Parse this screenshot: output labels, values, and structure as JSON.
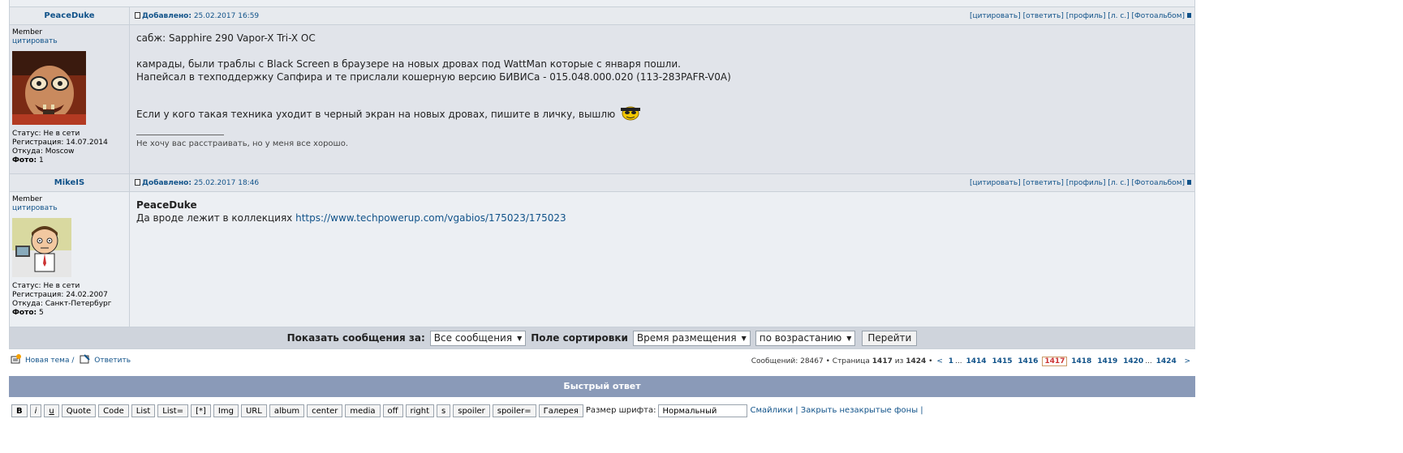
{
  "actions": {
    "quote": "[цитировать]",
    "reply": "[ответить]",
    "profile": "[профиль]",
    "pm": "[л. с.]",
    "photoalbum": "[Фотоальбом]"
  },
  "labels": {
    "added": "Добавлено:",
    "status": "Статус:",
    "registration": "Регистрация:",
    "from": "Откуда:",
    "photo": "Фото:"
  },
  "posts": [
    {
      "author": "PeaceDuke",
      "rank": "Member",
      "quote_link": "цитировать",
      "date": "25.02.2017 16:59",
      "status": "Не в сети",
      "registered": "14.07.2014",
      "location": "Moscow",
      "photos": "1",
      "lines": [
        "сабж: Sapphire 290 Vapor-X Tri-X OC",
        "камрады, были траблы с Black Screen в браузере на новых дровах под WattMan которые с января пошли.",
        "Напейсал в техподдержку Сапфира и те прислали кошерную версию БИВИСа - 015.048.000.020 (113-283PAFR-V0A)",
        "Если у кого такая техника уходит в черный экран на новых дровах, пишите в личку, вышлю"
      ],
      "signature": "Не хочу вас расстраивать, но у меня все хорошо."
    },
    {
      "author": "MikeIS",
      "rank": "Member",
      "quote_link": "цитировать",
      "date": "25.02.2017 18:46",
      "status": "Не в сети",
      "registered": "24.02.2007",
      "location": "Санкт-Петербург",
      "photos": "5",
      "reply_to": "PeaceDuke",
      "text": "Да вроде лежит в коллекциях",
      "link": "https://www.techpowerup.com/vgabios/175023/175023"
    }
  ],
  "sortbar": {
    "show_label": "Показать сообщения за:",
    "show_value": "Все сообщения",
    "sort_label": "Поле сортировки",
    "sort_value": "Время размещения",
    "order_value": "по возрастанию",
    "go_button": "Перейти"
  },
  "nav": {
    "new_topic": "Новая тема",
    "separator": "/",
    "reply": "Ответить",
    "messages_label": "Сообщений:",
    "messages_count": "28467",
    "page_label": "Страница",
    "current_page": "1417",
    "of_label": "из",
    "total_pages": "1424",
    "prev": "<",
    "next": ">",
    "pages": [
      "1",
      "...",
      "1414",
      "1415",
      "1416",
      "1417",
      "1418",
      "1419",
      "1420",
      "...",
      "1424"
    ]
  },
  "quick_reply": {
    "title": "Быстрый ответ",
    "buttons": [
      "B",
      "i",
      "u",
      "Quote",
      "Code",
      "List",
      "List=",
      "[*]",
      "Img",
      "URL",
      "album",
      "center",
      "media",
      "off",
      "right",
      "s",
      "spoiler",
      "spoiler=",
      "Галерея"
    ],
    "font_size_label": "Размер шрифта:",
    "font_size_value": "Нормальный",
    "links": "Смайлики | Закрыть незакрытые фоны |"
  }
}
